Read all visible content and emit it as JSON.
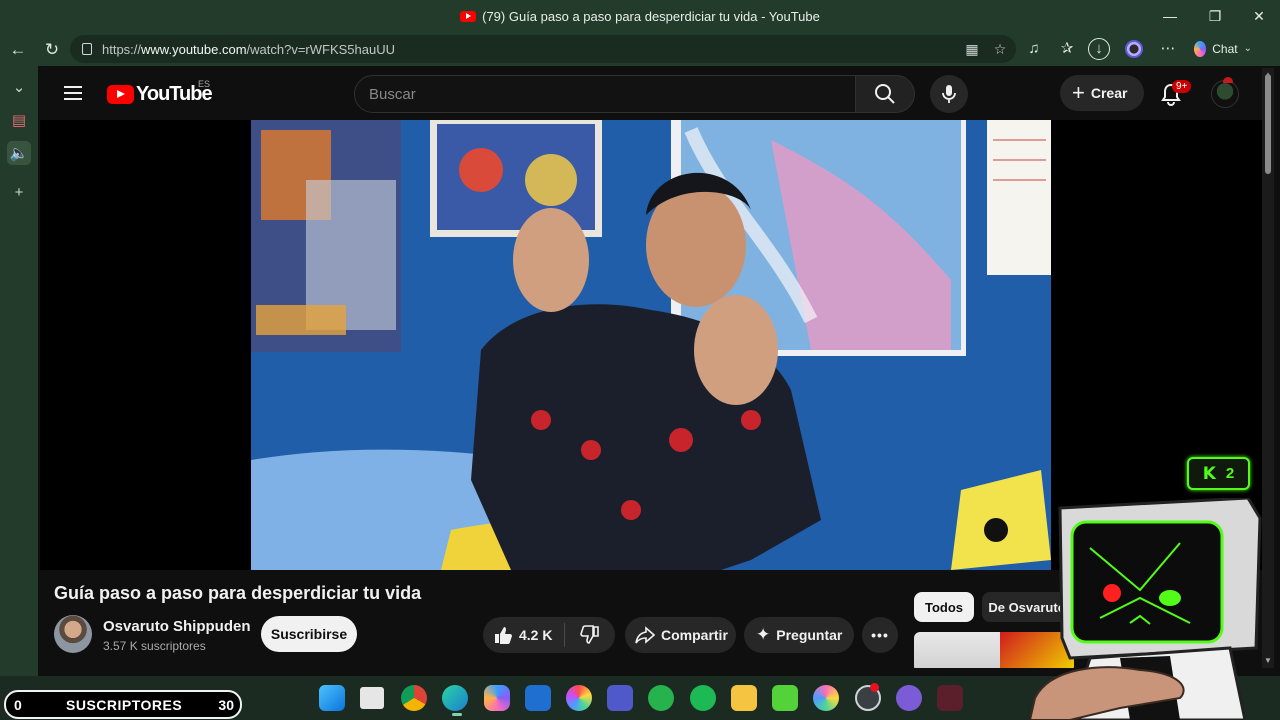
{
  "window": {
    "tab_title": "(79) Guía paso a paso para desperdiciar tu vida - YouTube",
    "minimize_icon": "minimize-icon",
    "maximize_icon": "maximize-icon",
    "close_icon": "close-icon"
  },
  "browser": {
    "url_prefix": "https://",
    "url_host": "www.youtube.com",
    "url_path": "/watch?v=rWFKS5hauUU",
    "chat_label": "Chat"
  },
  "youtube": {
    "logo_text": "YouTube",
    "country_code": "ES",
    "search_placeholder": "Buscar",
    "create_label": "Crear",
    "notifications_badge": "9+"
  },
  "video": {
    "title": "Guía paso a paso para desperdiciar tu vida",
    "channel_name": "Osvaruto Shippuden",
    "channel_subs": "3.57 K suscriptores",
    "subscribe_label": "Suscribirse",
    "likes": "4.2 K",
    "share_label": "Compartir",
    "ask_label": "Preguntar",
    "more_label": "•••"
  },
  "related": {
    "chips": [
      "Todos",
      "De Osvaruto"
    ]
  },
  "overlay": {
    "kick_count": "2",
    "kick_letter": "K",
    "sub_counter_left": "0",
    "sub_counter_label": "SUSCRIPTORES",
    "sub_counter_right": "30"
  },
  "colors": {
    "browser_chrome": "#233b2b",
    "youtube_red": "#ff0000",
    "kick_green": "#53fc18"
  }
}
